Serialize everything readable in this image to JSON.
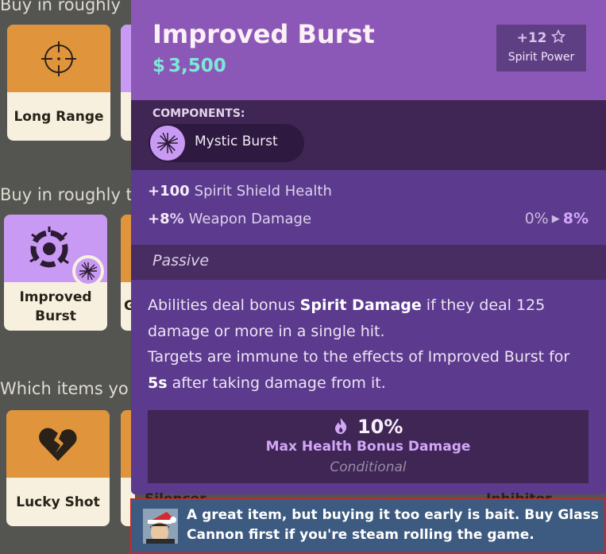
{
  "tiers": [
    {
      "heading": "Buy in roughly",
      "card": {
        "label": "Long Range",
        "icon": "crosshair-icon",
        "color": "orange"
      }
    },
    {
      "heading": "Buy in roughly th",
      "card": {
        "label": "Improved Burst",
        "icon": "improved-burst-icon",
        "color": "purple",
        "peek_label": "G"
      }
    },
    {
      "heading": "Which items yo",
      "card": {
        "label": "Lucky Shot",
        "icon": "broken-heart-icon",
        "color": "orange"
      }
    }
  ],
  "under_labels": [
    "Silencer",
    "Inhibitor"
  ],
  "tooltip": {
    "title": "Improved Burst",
    "price_symbol": "$",
    "price": "3,500",
    "spirit_power": {
      "value": "+12",
      "icon": "star-outline-icon",
      "label": "Spirit Power"
    },
    "components_label": "COMPONENTS:",
    "components": [
      {
        "name": "Mystic Burst",
        "icon": "burst-icon"
      }
    ],
    "stats": [
      {
        "value": "+100",
        "unit": "",
        "label": "Spirit Shield Health"
      },
      {
        "value": "+8",
        "unit": "%",
        "label": "Weapon Damage",
        "from": "0%",
        "to": "8%"
      }
    ],
    "passive_label": "Passive",
    "description": {
      "p1_a": "Abilities deal bonus ",
      "p1_b": "Spirit Damage",
      "p1_c": " if they deal 125 damage or more in a single hit.",
      "p2_a": "Targets are immune to the effects of Improved Burst for ",
      "p2_b": "5s",
      "p2_c": " after taking damage from it."
    },
    "conditional": {
      "value": "10%",
      "icon": "flame-icon",
      "name": "Max Health Bonus Damage",
      "tag": "Conditional"
    }
  },
  "comment": {
    "text": "A great item, but buying it too early is bait. Buy Glass Cannon first if you're steam rolling the game."
  },
  "colors": {
    "accent_teal": "#7ee8d6",
    "accent_purple": "#d2a7f8",
    "highlight_border": "#d42323"
  }
}
